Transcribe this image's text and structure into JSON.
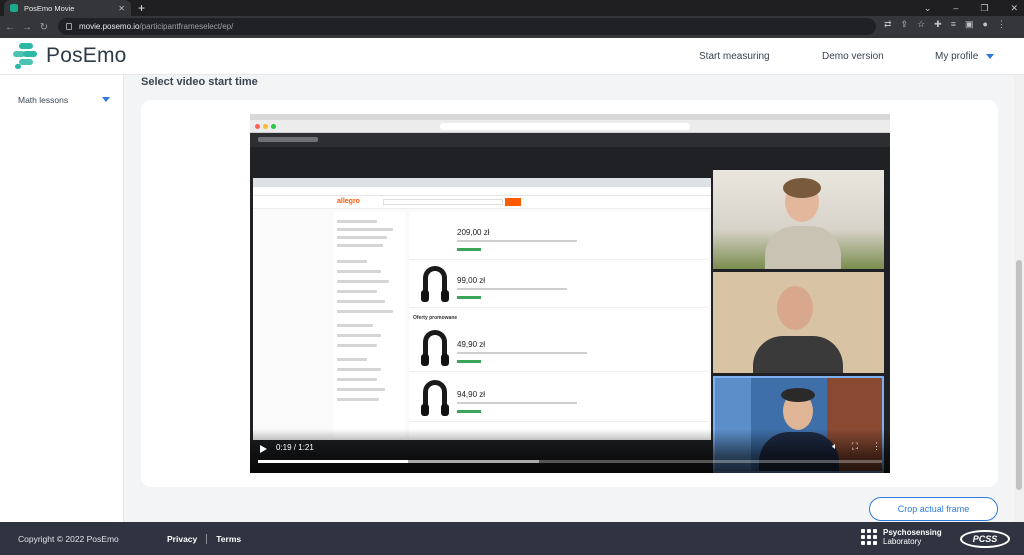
{
  "browser": {
    "tab_title": "PosEmo Movie",
    "url_host": "movie.posemo.io",
    "url_path": "/participantframeselect/ep/"
  },
  "header": {
    "logo_text": "PosEmo",
    "nav": {
      "start_measuring": "Start measuring",
      "demo_version": "Demo version",
      "my_profile": "My profile"
    },
    "accent_color": "#2e7bd6",
    "brand_color": "#2bb8a4"
  },
  "sidebar": {
    "items": [
      {
        "label": "Math lessons",
        "icon": "chevron-down-icon"
      }
    ]
  },
  "main": {
    "section_title": "Select video start time",
    "video": {
      "time_display": "0:19 / 1:21",
      "progress_fraction": 0.24,
      "buffered_fraction": 0.45,
      "content": {
        "shared_site": "allegro",
        "prices": [
          "209,00 zł",
          "99,00 zł",
          "49,90 zł",
          "94,90 zł"
        ],
        "promo_label": "Oferty promowane"
      }
    },
    "crop_button_label": "Crop actual frame"
  },
  "footer": {
    "copyright": "Copyright © 2022 PosEmo",
    "links": [
      "Privacy",
      "Terms"
    ],
    "lab_name_line1": "Psychosensing",
    "lab_name_line2": "Laboratory",
    "pcss_logo": "PCSS"
  }
}
